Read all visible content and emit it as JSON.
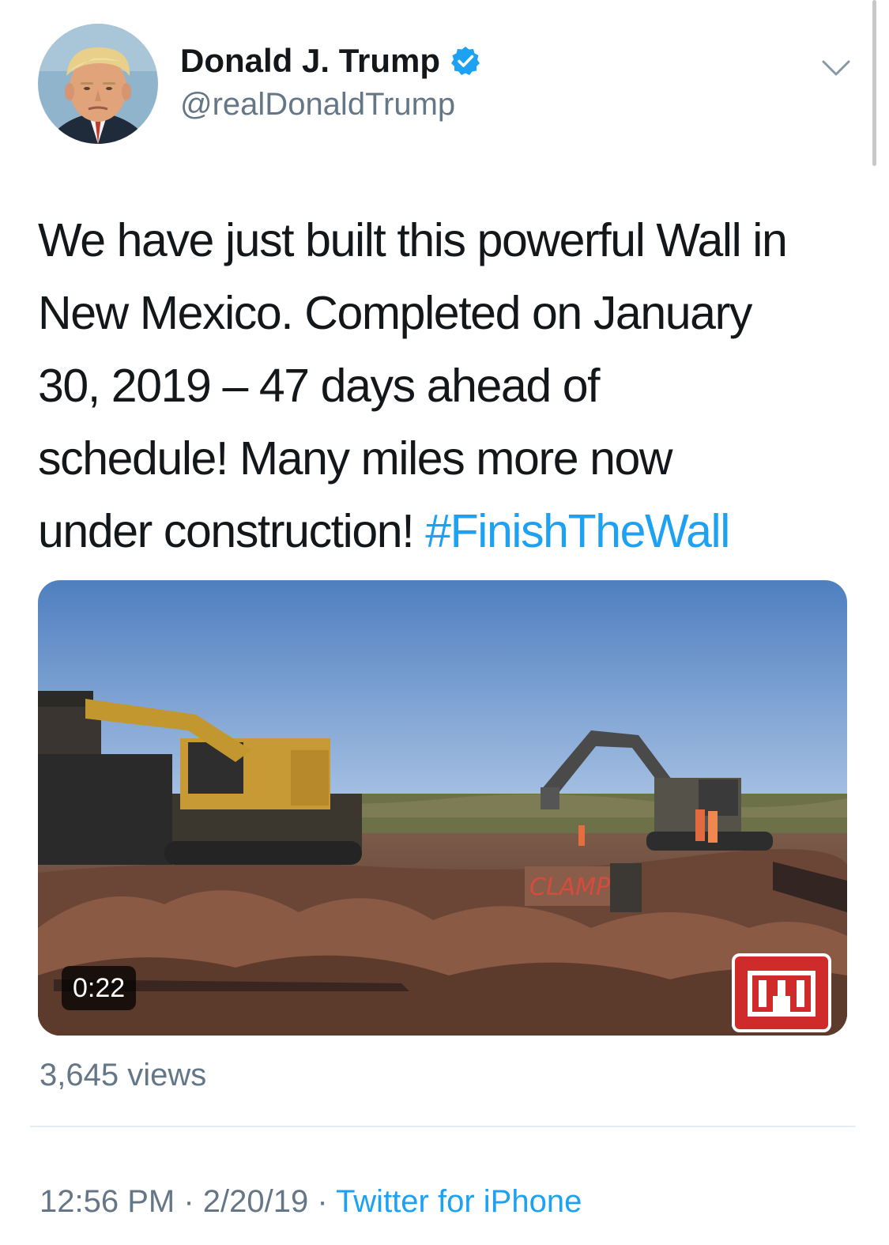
{
  "user": {
    "display_name": "Donald J. Trump",
    "handle": "@realDonaldTrump",
    "verified": true
  },
  "icons": {
    "verified": "verified-badge-icon",
    "menu": "chevron-down-icon",
    "video_logo": "usace-castle-logo"
  },
  "tweet": {
    "text_lines": [
      "We have just built this powerful Wall in",
      "New Mexico. Completed on January",
      "30, 2019 – 47 days ahead of",
      "schedule! Many miles more now",
      "under construction! "
    ],
    "hashtag": "#FinishTheWall"
  },
  "media": {
    "duration": "0:22",
    "views": "3,645 views"
  },
  "meta": {
    "time": "12:56 PM",
    "separator": " · ",
    "date": "2/20/19",
    "source": "Twitter for iPhone"
  },
  "colors": {
    "accent": "#1da1f2",
    "secondary_text": "#657786",
    "primary_text": "#14171a",
    "divider": "#e6ecf0"
  }
}
